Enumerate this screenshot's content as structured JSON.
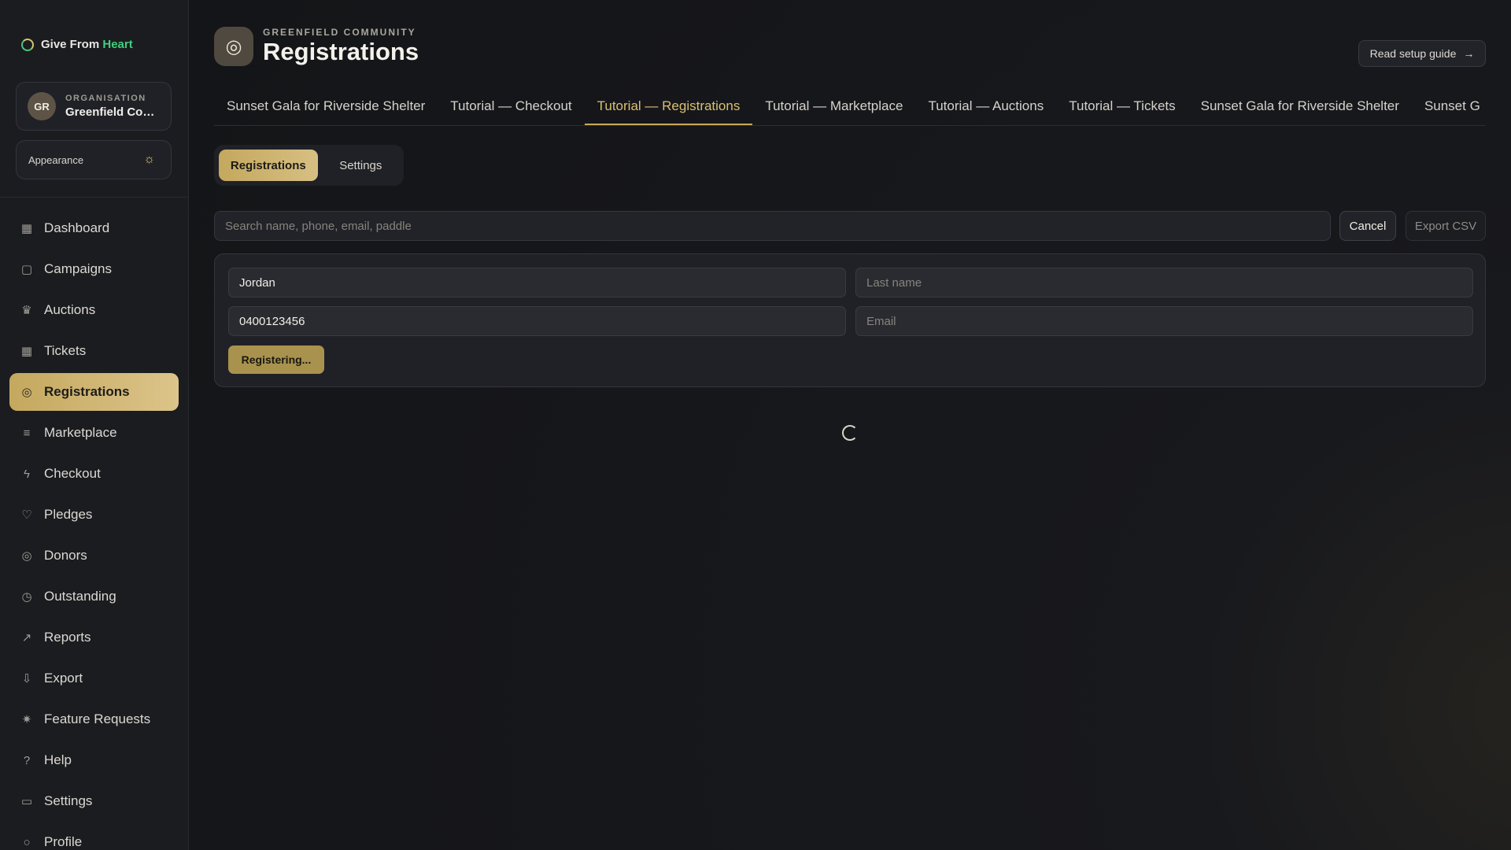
{
  "brand": {
    "name_prefix": "Give From",
    "name_accent": "Heart"
  },
  "organisation": {
    "initials": "GR",
    "label": "ORGANISATION",
    "name": "Greenfield Com..."
  },
  "appearance": {
    "label": "Appearance",
    "icon": "sun-icon"
  },
  "sidebar": {
    "items": [
      {
        "label": "Dashboard",
        "icon": "dashboard-icon"
      },
      {
        "label": "Campaigns",
        "icon": "calendar-icon"
      },
      {
        "label": "Auctions",
        "icon": "trophy-icon"
      },
      {
        "label": "Tickets",
        "icon": "ticket-icon"
      },
      {
        "label": "Registrations",
        "icon": "users-icon",
        "active": true
      },
      {
        "label": "Marketplace",
        "icon": "list-icon"
      },
      {
        "label": "Checkout",
        "icon": "bolt-icon"
      },
      {
        "label": "Pledges",
        "icon": "heart-icon"
      },
      {
        "label": "Donors",
        "icon": "users-icon"
      },
      {
        "label": "Outstanding",
        "icon": "clock-icon"
      },
      {
        "label": "Reports",
        "icon": "trend-icon"
      },
      {
        "label": "Export",
        "icon": "download-icon"
      },
      {
        "label": "Feature Requests",
        "icon": "sparkle-icon"
      },
      {
        "label": "Help",
        "icon": "help-icon"
      },
      {
        "label": "Settings",
        "icon": "card-icon"
      },
      {
        "label": "Profile",
        "icon": "user-icon"
      }
    ]
  },
  "header": {
    "kicker": "GREENFIELD COMMUNITY",
    "title": "Registrations",
    "guide_label": "Read setup guide",
    "guide_icon": "arrow-right-icon"
  },
  "event_tabs": [
    {
      "label": "Sunset Gala for Riverside Shelter"
    },
    {
      "label": "Tutorial — Checkout"
    },
    {
      "label": "Tutorial — Registrations",
      "active": true
    },
    {
      "label": "Tutorial — Marketplace"
    },
    {
      "label": "Tutorial — Auctions"
    },
    {
      "label": "Tutorial — Tickets"
    },
    {
      "label": "Sunset Gala for Riverside Shelter"
    },
    {
      "label": "Sunset G"
    }
  ],
  "sub_tabs": [
    {
      "label": "Registrations",
      "active": true
    },
    {
      "label": "Settings"
    }
  ],
  "search": {
    "placeholder": "Search name, phone, email, paddle"
  },
  "actions": {
    "cancel_label": "Cancel",
    "export_label": "Export CSV"
  },
  "form": {
    "first_name": {
      "value": "Jordan",
      "placeholder": ""
    },
    "last_name": {
      "value": "",
      "placeholder": "Last name"
    },
    "phone": {
      "value": "0400123456",
      "placeholder": ""
    },
    "email": {
      "value": "",
      "placeholder": "Email"
    },
    "submit_label": "Registering..."
  },
  "colors": {
    "accent_gold": "#c4a85e",
    "brand_green": "#3fcf7c",
    "background": "#16171a",
    "panel": "#202126"
  }
}
